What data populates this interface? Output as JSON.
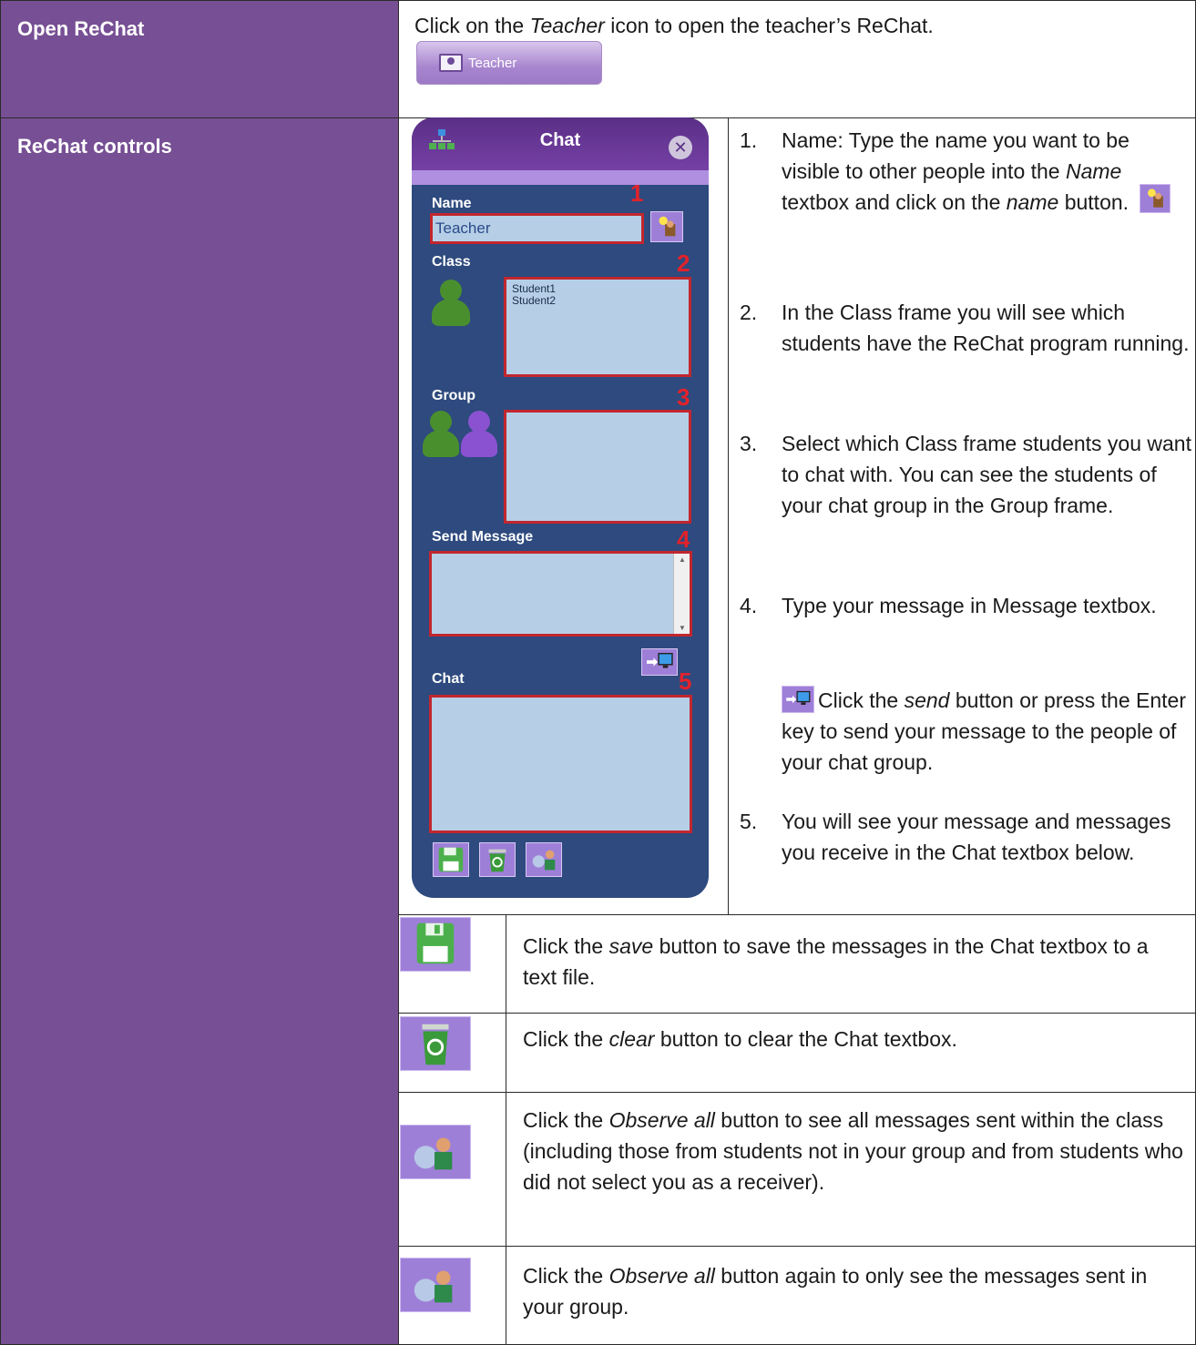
{
  "rows": {
    "open": {
      "label": "Open ReChat",
      "text_before": "Click on the ",
      "text_italic": "Teacher",
      "text_after": " icon to open the teacher’s ReChat.",
      "button_label": "Teacher"
    },
    "controls": {
      "label": "ReChat controls"
    }
  },
  "chat_window": {
    "title": "Chat",
    "name_label": "Name",
    "name_value": "Teacher",
    "class_label": "Class",
    "class_list": [
      "Student1",
      "Student2"
    ],
    "group_label": "Group",
    "send_label": "Send Message",
    "chat_label": "Chat",
    "markers": [
      "1",
      "2",
      "3",
      "4",
      "5"
    ]
  },
  "steps": [
    {
      "num": "1.",
      "parts": [
        "Name: Type the name you want to be visible to other people into the ",
        "Name",
        " textbox and click on the ",
        "name",
        " button."
      ]
    },
    {
      "num": "2.",
      "text": "In the Class frame you will see which students have the ReChat program running."
    },
    {
      "num": "3.",
      "text": "Select which Class frame students you want to chat with. You can see the students of your chat group in the Group frame."
    },
    {
      "num": "4.",
      "text": "Type your message in Message textbox.",
      "sub": [
        "Click the ",
        "send",
        " button or press the Enter key to send your message to the people of your chat group."
      ]
    },
    {
      "num": "5.",
      "text": "You will see your message and messages you receive in the Chat textbox below."
    }
  ],
  "buttons_rows": [
    {
      "icon": "save-icon",
      "parts": [
        "Click the ",
        "save",
        " button to save the messages in the Chat textbox to a text file."
      ]
    },
    {
      "icon": "recycle-bin-icon",
      "parts": [
        "Click the ",
        "clear",
        " button to clear the Chat textbox."
      ]
    },
    {
      "icon": "observe-all-icon",
      "parts": [
        "Click the ",
        "Observe all",
        " button to see all messages sent within the class (including those from students not in your group and from students who did not select you as a receiver)."
      ]
    },
    {
      "icon": "observe-all-icon",
      "parts": [
        "Click the ",
        "Observe all",
        " button again to only see the messages sent in your group."
      ]
    }
  ],
  "colors": {
    "sidebar": "#774f94",
    "marker_red": "#e2222b",
    "panel_blue": "#2e4a7e",
    "box_fill": "#b6cfe6"
  }
}
